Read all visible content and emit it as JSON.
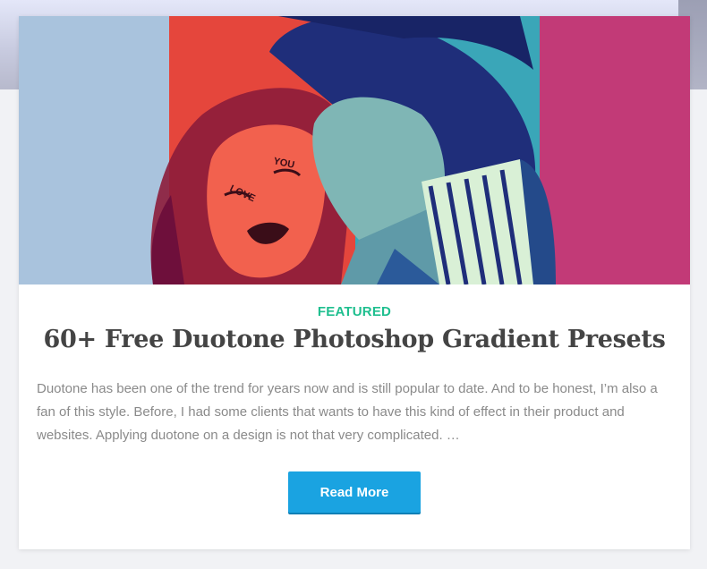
{
  "post": {
    "category": "FEATURED",
    "title": "60+ Free Duotone Photoshop Gradient Presets",
    "excerpt": "Duotone has been one of the trend for years now and is still popular to date. And to be honest, I’m also a fan of this style. Before, I had some clients that wants to have this kind of effect in their product and websites. Applying duotone on a design is not that very complicated. …",
    "read_more_label": "Read More",
    "image": {
      "description_icon": "duotone-couple-photo",
      "panel_colors": [
        "#a9c3dd",
        "#e5463c",
        "#3aa6b8",
        "#c23a77"
      ],
      "face_text_left": "LOVE",
      "face_text_right": "YOU"
    }
  },
  "colors": {
    "category": "#1fbf8f",
    "title": "#444444",
    "excerpt": "#8a8a8a",
    "button": "#1aa3e1"
  }
}
